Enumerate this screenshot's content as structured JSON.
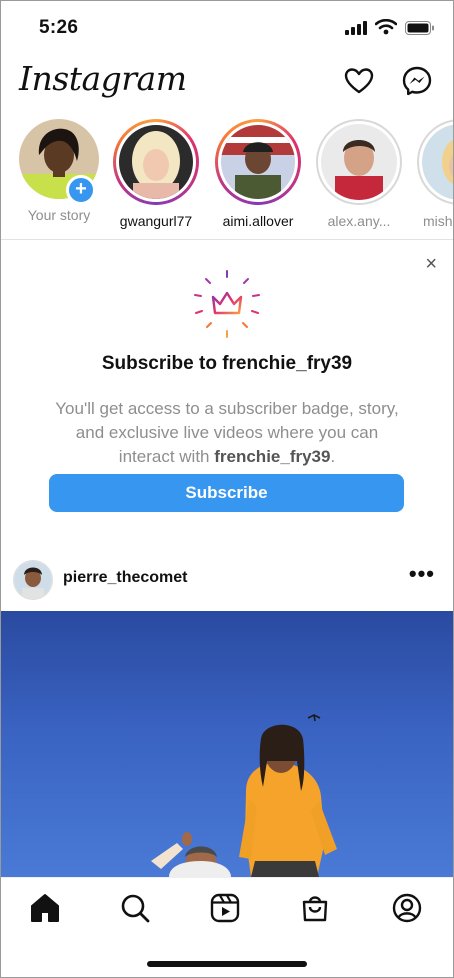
{
  "status_bar": {
    "time": "5:26"
  },
  "app": {
    "title": "Instagram"
  },
  "stories": [
    {
      "label": "Your story",
      "own": true
    },
    {
      "label": "gwangurl77"
    },
    {
      "label": "aimi.allover"
    },
    {
      "label": "alex.any..."
    },
    {
      "label": "mish"
    }
  ],
  "subscribe_card": {
    "title": "Subscribe to frenchie_fry39",
    "desc_prefix": "You'll get access to a subscriber badge, story, and exclusive live videos where you can interact with ",
    "desc_user": "frenchie_fry39",
    "desc_suffix": ".",
    "button": "Subscribe",
    "close": "×"
  },
  "post": {
    "username": "pierre_thecomet",
    "more": "•••"
  },
  "colors": {
    "accent": "#3797f0",
    "muted": "#8e8e8e"
  },
  "icons": {
    "header": [
      "heart-icon",
      "messenger-icon"
    ],
    "nav": [
      "home-icon",
      "search-icon",
      "reels-icon",
      "shop-icon",
      "profile-icon"
    ]
  }
}
